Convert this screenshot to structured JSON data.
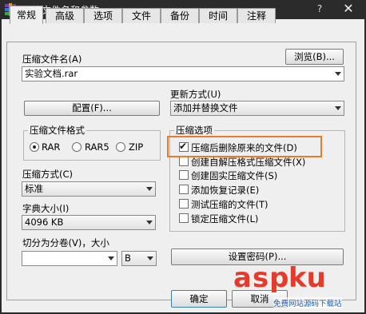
{
  "window": {
    "title": "压缩文件名和参数",
    "help": "?",
    "close": "✕"
  },
  "tabs": [
    {
      "label": "常规",
      "active": true
    },
    {
      "label": "高级"
    },
    {
      "label": "选项"
    },
    {
      "label": "文件"
    },
    {
      "label": "备份"
    },
    {
      "label": "时间"
    },
    {
      "label": "注释"
    }
  ],
  "archive_name": {
    "label": "压缩文件名(A)",
    "value": "实验文档.rar",
    "browse": "浏览(B)..."
  },
  "profile_button": "配置(F)...",
  "update_mode": {
    "label": "更新方式(U)",
    "value": "添加并替换文件"
  },
  "format": {
    "legend": "压缩文件格式",
    "options": [
      {
        "label": "RAR",
        "selected": true
      },
      {
        "label": "RAR5",
        "selected": false
      },
      {
        "label": "ZIP",
        "selected": false
      }
    ]
  },
  "method": {
    "label": "压缩方式(C)",
    "value": "标准"
  },
  "dictionary": {
    "label": "字典大小(I)",
    "value": "4096 KB"
  },
  "split": {
    "label": "切分为分卷(V)，大小",
    "value": "",
    "unit": "B"
  },
  "options": {
    "legend": "压缩选项",
    "items": [
      {
        "label": "压缩后删除原来的文件(D)",
        "checked": true
      },
      {
        "label": "创建自解压格式压缩文件(X)",
        "checked": false
      },
      {
        "label": "创建固实压缩文件(S)",
        "checked": false
      },
      {
        "label": "添加恢复记录(E)",
        "checked": false
      },
      {
        "label": "测试压缩的文件(T)",
        "checked": false
      },
      {
        "label": "锁定压缩文件(L)",
        "checked": false
      }
    ]
  },
  "password_button": "设置密码(P)...",
  "footer": {
    "ok": "确定",
    "cancel": "取消"
  },
  "watermark": {
    "brand_a": "asp",
    "brand_b": "ku",
    "tagline": "免费网站源码下载站"
  },
  "colors": {
    "highlight": "#e77b2a",
    "titlebar": "#2b2b2b",
    "watermark_red": "#e43b2a"
  }
}
